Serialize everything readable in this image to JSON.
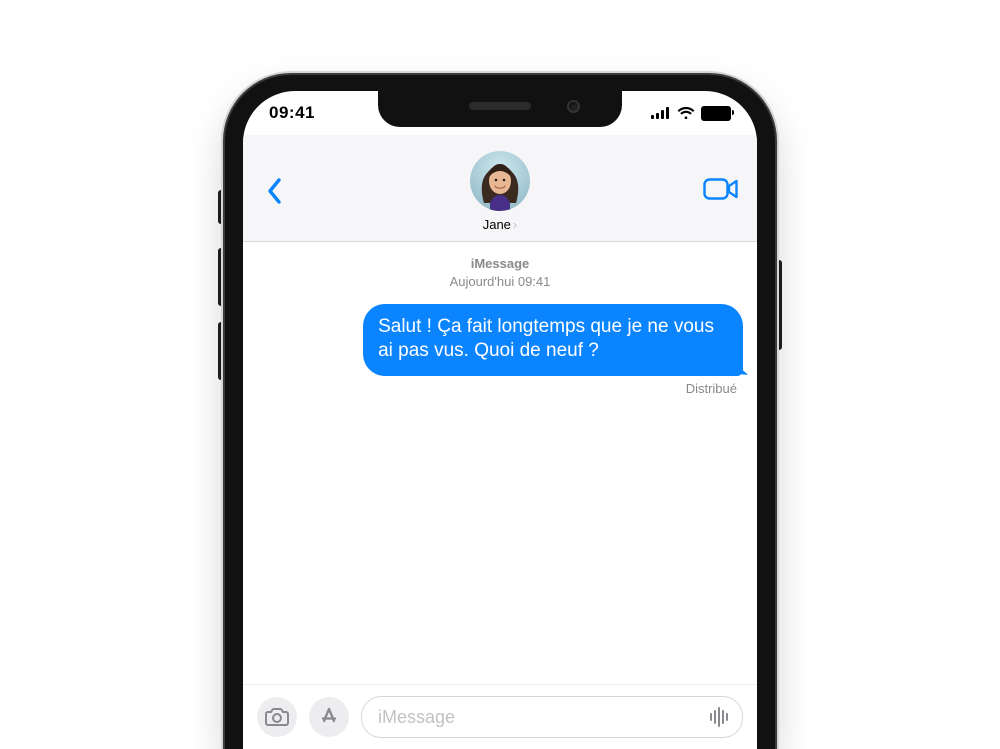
{
  "status": {
    "time": "09:41"
  },
  "header": {
    "contact_name": "Jane"
  },
  "thread": {
    "service_label": "iMessage",
    "timestamp": "Aujourd'hui 09:41",
    "messages": [
      {
        "direction": "sent",
        "text": "Salut ! Ça fait longtemps que je ne vous ai pas vus. Quoi de neuf ?",
        "receipt": "Distribué"
      }
    ]
  },
  "input": {
    "placeholder": "iMessage"
  },
  "colors": {
    "accent": "#0a84ff",
    "bubble_sent": "#0b84ff",
    "header_bg": "#f6f6f8",
    "meta_text": "#8a8a8e"
  }
}
